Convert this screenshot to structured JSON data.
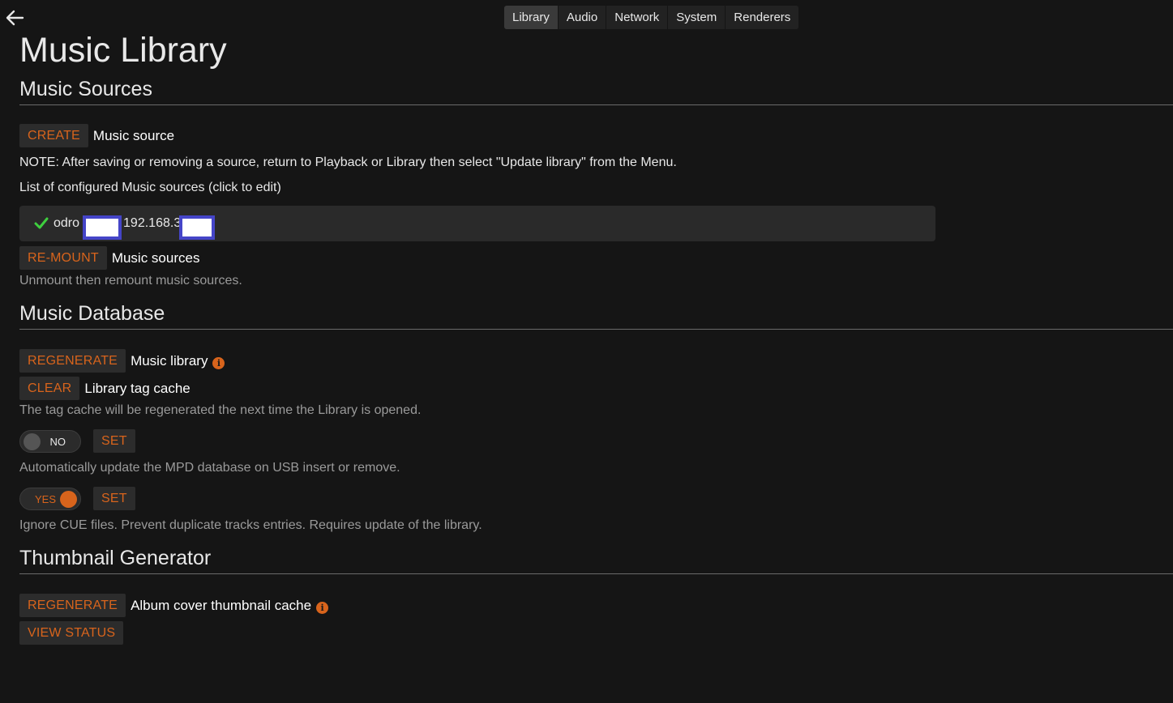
{
  "nav": {
    "tabs": [
      {
        "label": "Library"
      },
      {
        "label": "Audio"
      },
      {
        "label": "Network"
      },
      {
        "label": "System"
      },
      {
        "label": "Renderers"
      }
    ]
  },
  "page": {
    "title": "Music Library"
  },
  "music_sources": {
    "heading": "Music Sources",
    "create_button": "CREATE",
    "create_label": "Music source",
    "note": "NOTE: After saving or removing a source, return to Playback or Library then select \"Update library\" from the Menu.",
    "list_caption": "List of configured Music sources (click to edit)",
    "source_name": "odro",
    "source_ip": "192.168.3",
    "remount_button": "RE-MOUNT",
    "remount_label": "Music sources",
    "remount_help": "Unmount then remount music sources."
  },
  "music_database": {
    "heading": "Music Database",
    "regenerate_button": "REGENERATE",
    "regenerate_label": "Music library",
    "clear_button": "CLEAR",
    "clear_label": "Library tag cache",
    "clear_help": "The tag cache will be regenerated the next time the Library is opened.",
    "usb_toggle_label": "NO",
    "usb_set_button": "SET",
    "usb_help": "Automatically update the MPD database on USB insert or remove.",
    "cue_toggle_label": "YES",
    "cue_set_button": "SET",
    "cue_help": "Ignore CUE files. Prevent duplicate tracks entries. Requires update of the library."
  },
  "thumbnail_generator": {
    "heading": "Thumbnail Generator",
    "regenerate_button": "REGENERATE",
    "regenerate_label": "Album cover thumbnail cache",
    "view_status_button": "VIEW STATUS"
  },
  "colors": {
    "accent": "#d8641c",
    "background": "#151515",
    "check": "#3ecf3e"
  }
}
